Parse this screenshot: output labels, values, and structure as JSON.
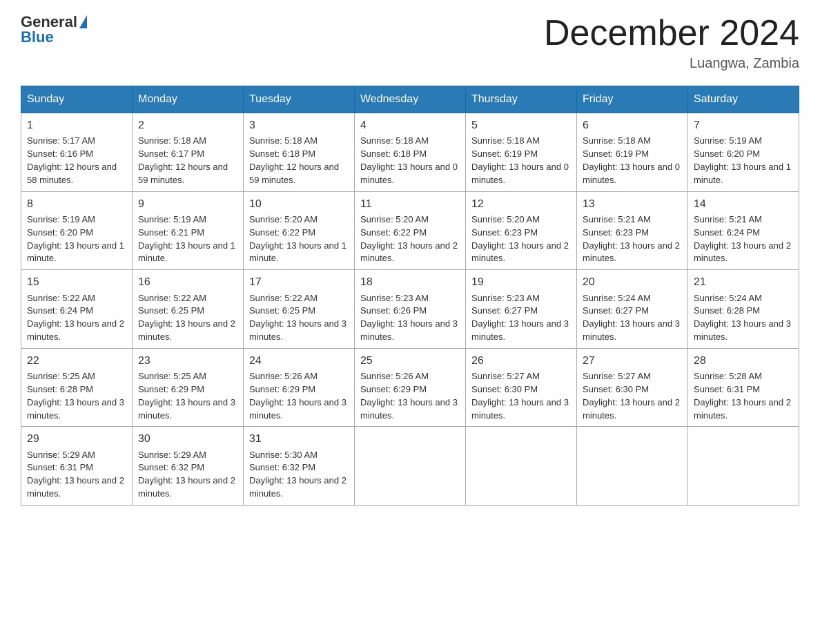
{
  "header": {
    "logo_general": "General",
    "logo_blue": "Blue",
    "month_title": "December 2024",
    "location": "Luangwa, Zambia"
  },
  "columns": [
    "Sunday",
    "Monday",
    "Tuesday",
    "Wednesday",
    "Thursday",
    "Friday",
    "Saturday"
  ],
  "weeks": [
    [
      {
        "day": "1",
        "sunrise": "Sunrise: 5:17 AM",
        "sunset": "Sunset: 6:16 PM",
        "daylight": "Daylight: 12 hours and 58 minutes."
      },
      {
        "day": "2",
        "sunrise": "Sunrise: 5:18 AM",
        "sunset": "Sunset: 6:17 PM",
        "daylight": "Daylight: 12 hours and 59 minutes."
      },
      {
        "day": "3",
        "sunrise": "Sunrise: 5:18 AM",
        "sunset": "Sunset: 6:18 PM",
        "daylight": "Daylight: 12 hours and 59 minutes."
      },
      {
        "day": "4",
        "sunrise": "Sunrise: 5:18 AM",
        "sunset": "Sunset: 6:18 PM",
        "daylight": "Daylight: 13 hours and 0 minutes."
      },
      {
        "day": "5",
        "sunrise": "Sunrise: 5:18 AM",
        "sunset": "Sunset: 6:19 PM",
        "daylight": "Daylight: 13 hours and 0 minutes."
      },
      {
        "day": "6",
        "sunrise": "Sunrise: 5:18 AM",
        "sunset": "Sunset: 6:19 PM",
        "daylight": "Daylight: 13 hours and 0 minutes."
      },
      {
        "day": "7",
        "sunrise": "Sunrise: 5:19 AM",
        "sunset": "Sunset: 6:20 PM",
        "daylight": "Daylight: 13 hours and 1 minute."
      }
    ],
    [
      {
        "day": "8",
        "sunrise": "Sunrise: 5:19 AM",
        "sunset": "Sunset: 6:20 PM",
        "daylight": "Daylight: 13 hours and 1 minute."
      },
      {
        "day": "9",
        "sunrise": "Sunrise: 5:19 AM",
        "sunset": "Sunset: 6:21 PM",
        "daylight": "Daylight: 13 hours and 1 minute."
      },
      {
        "day": "10",
        "sunrise": "Sunrise: 5:20 AM",
        "sunset": "Sunset: 6:22 PM",
        "daylight": "Daylight: 13 hours and 1 minute."
      },
      {
        "day": "11",
        "sunrise": "Sunrise: 5:20 AM",
        "sunset": "Sunset: 6:22 PM",
        "daylight": "Daylight: 13 hours and 2 minutes."
      },
      {
        "day": "12",
        "sunrise": "Sunrise: 5:20 AM",
        "sunset": "Sunset: 6:23 PM",
        "daylight": "Daylight: 13 hours and 2 minutes."
      },
      {
        "day": "13",
        "sunrise": "Sunrise: 5:21 AM",
        "sunset": "Sunset: 6:23 PM",
        "daylight": "Daylight: 13 hours and 2 minutes."
      },
      {
        "day": "14",
        "sunrise": "Sunrise: 5:21 AM",
        "sunset": "Sunset: 6:24 PM",
        "daylight": "Daylight: 13 hours and 2 minutes."
      }
    ],
    [
      {
        "day": "15",
        "sunrise": "Sunrise: 5:22 AM",
        "sunset": "Sunset: 6:24 PM",
        "daylight": "Daylight: 13 hours and 2 minutes."
      },
      {
        "day": "16",
        "sunrise": "Sunrise: 5:22 AM",
        "sunset": "Sunset: 6:25 PM",
        "daylight": "Daylight: 13 hours and 2 minutes."
      },
      {
        "day": "17",
        "sunrise": "Sunrise: 5:22 AM",
        "sunset": "Sunset: 6:25 PM",
        "daylight": "Daylight: 13 hours and 3 minutes."
      },
      {
        "day": "18",
        "sunrise": "Sunrise: 5:23 AM",
        "sunset": "Sunset: 6:26 PM",
        "daylight": "Daylight: 13 hours and 3 minutes."
      },
      {
        "day": "19",
        "sunrise": "Sunrise: 5:23 AM",
        "sunset": "Sunset: 6:27 PM",
        "daylight": "Daylight: 13 hours and 3 minutes."
      },
      {
        "day": "20",
        "sunrise": "Sunrise: 5:24 AM",
        "sunset": "Sunset: 6:27 PM",
        "daylight": "Daylight: 13 hours and 3 minutes."
      },
      {
        "day": "21",
        "sunrise": "Sunrise: 5:24 AM",
        "sunset": "Sunset: 6:28 PM",
        "daylight": "Daylight: 13 hours and 3 minutes."
      }
    ],
    [
      {
        "day": "22",
        "sunrise": "Sunrise: 5:25 AM",
        "sunset": "Sunset: 6:28 PM",
        "daylight": "Daylight: 13 hours and 3 minutes."
      },
      {
        "day": "23",
        "sunrise": "Sunrise: 5:25 AM",
        "sunset": "Sunset: 6:29 PM",
        "daylight": "Daylight: 13 hours and 3 minutes."
      },
      {
        "day": "24",
        "sunrise": "Sunrise: 5:26 AM",
        "sunset": "Sunset: 6:29 PM",
        "daylight": "Daylight: 13 hours and 3 minutes."
      },
      {
        "day": "25",
        "sunrise": "Sunrise: 5:26 AM",
        "sunset": "Sunset: 6:29 PM",
        "daylight": "Daylight: 13 hours and 3 minutes."
      },
      {
        "day": "26",
        "sunrise": "Sunrise: 5:27 AM",
        "sunset": "Sunset: 6:30 PM",
        "daylight": "Daylight: 13 hours and 3 minutes."
      },
      {
        "day": "27",
        "sunrise": "Sunrise: 5:27 AM",
        "sunset": "Sunset: 6:30 PM",
        "daylight": "Daylight: 13 hours and 2 minutes."
      },
      {
        "day": "28",
        "sunrise": "Sunrise: 5:28 AM",
        "sunset": "Sunset: 6:31 PM",
        "daylight": "Daylight: 13 hours and 2 minutes."
      }
    ],
    [
      {
        "day": "29",
        "sunrise": "Sunrise: 5:29 AM",
        "sunset": "Sunset: 6:31 PM",
        "daylight": "Daylight: 13 hours and 2 minutes."
      },
      {
        "day": "30",
        "sunrise": "Sunrise: 5:29 AM",
        "sunset": "Sunset: 6:32 PM",
        "daylight": "Daylight: 13 hours and 2 minutes."
      },
      {
        "day": "31",
        "sunrise": "Sunrise: 5:30 AM",
        "sunset": "Sunset: 6:32 PM",
        "daylight": "Daylight: 13 hours and 2 minutes."
      },
      null,
      null,
      null,
      null
    ]
  ]
}
